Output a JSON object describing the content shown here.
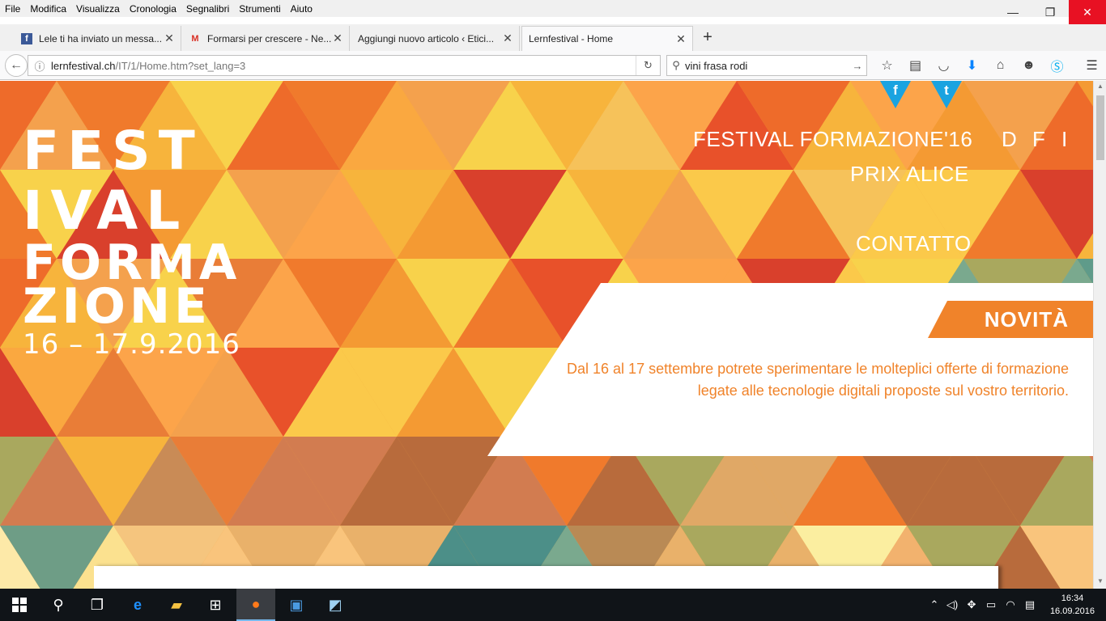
{
  "menubar": {
    "items": [
      "File",
      "Modifica",
      "Visualizza",
      "Cronologia",
      "Segnalibri",
      "Strumenti",
      "Aiuto"
    ]
  },
  "window_controls": {
    "minimize": "—",
    "restore": "❐",
    "close": "✕"
  },
  "tabs": [
    {
      "title": "Lele ti ha inviato un messa...",
      "icon": "f"
    },
    {
      "title": "Formarsi per crescere - Ne...",
      "icon": "M"
    },
    {
      "title": "Aggiungi nuovo articolo ‹ Etici...",
      "icon": ""
    },
    {
      "title": "Lernfestival - Home",
      "icon": ""
    }
  ],
  "url": {
    "domain": "lernfestival.ch",
    "path": "/IT/1/Home.htm?set_lang=3"
  },
  "search": {
    "value": "vini frasa rodi"
  },
  "logo": {
    "line1": "FEST",
    "line2": "IVAL",
    "line3": "FORMA",
    "line4": "ZIONE",
    "date": "16 – 17.9.2016"
  },
  "nav": {
    "festival": "FESTIVAL FORMAZIONE'16",
    "prix": "PRIX ALICE",
    "contact": "CONTATTO",
    "lang_d": "D",
    "lang_f": "F",
    "lang_i": "I"
  },
  "social": {
    "facebook": "f",
    "twitter": "t"
  },
  "news": {
    "badge": "NOVITÀ",
    "text": "Dal 16 al 17 settembre potrete sperimentare le molteplici offerte di formazione legate alle tecnologie digitali proposte sul vostro territorio."
  },
  "clock": {
    "time": "16:34",
    "date": "16.09.2016"
  },
  "colors": {
    "accent_orange": "#f0832a",
    "close_red": "#e81123",
    "taskbar": "#101418"
  }
}
